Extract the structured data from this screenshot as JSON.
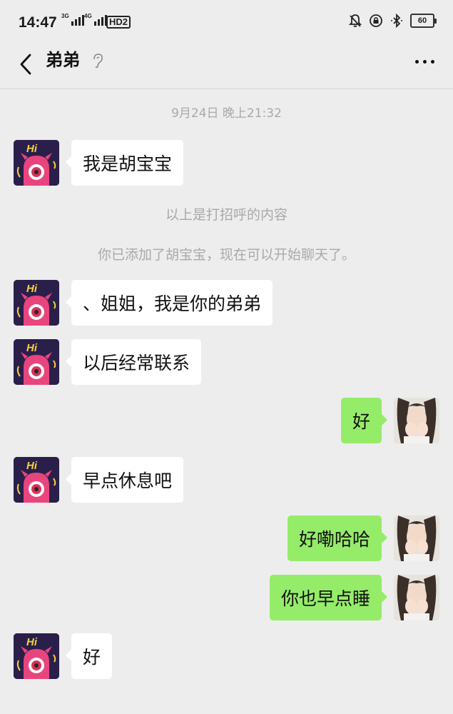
{
  "status_bar": {
    "time": "14:47",
    "signal_1_type": "3G",
    "signal_2_type": "4G",
    "hd_label": "HD2",
    "battery_level": "60"
  },
  "nav": {
    "title": "弟弟"
  },
  "chat": {
    "timestamp": "9月24日 晚上21:32",
    "system_messages": [
      "以上是打招呼的内容",
      "你已添加了胡宝宝，现在可以开始聊天了。"
    ],
    "messages": [
      {
        "from": "contact",
        "text": "我是胡宝宝"
      },
      {
        "from": "contact",
        "text": "、姐姐，我是你的弟弟"
      },
      {
        "from": "contact",
        "text": "以后经常联系"
      },
      {
        "from": "me",
        "text": "好"
      },
      {
        "from": "contact",
        "text": "早点休息吧"
      },
      {
        "from": "me",
        "text": "好嘞哈哈"
      },
      {
        "from": "me",
        "text": "你也早点睡"
      },
      {
        "from": "contact",
        "text": "好"
      }
    ],
    "contact_avatar_text": "Hi"
  },
  "colors": {
    "background": "#ededed",
    "sent_bubble": "#95ec69",
    "received_bubble": "#ffffff",
    "avatar_pink": "#e8457e",
    "avatar_bg": "#2a1f4b"
  }
}
